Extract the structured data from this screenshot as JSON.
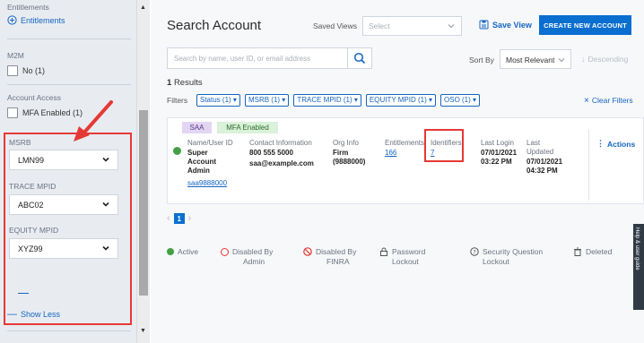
{
  "sidebar": {
    "top_cutoff_label": "Entitlements",
    "entitlements_label": "Entitlements",
    "m2m": {
      "label": "M2M",
      "option": "No (1)"
    },
    "account_access": {
      "label": "Account Access",
      "option": "MFA Enabled (1)"
    },
    "msrb": {
      "label": "MSRB",
      "value": "LMN99"
    },
    "trace_mpid": {
      "label": "TRACE MPID",
      "value": "ABC02"
    },
    "equity_mpid": {
      "label": "EQUITY MPID",
      "value": "XYZ99"
    },
    "show_less": "Show Less"
  },
  "header": {
    "title": "Search Account",
    "saved_views_label": "Saved Views",
    "saved_views_placeholder": "Select",
    "save_view": "Save View",
    "create_account": "CREATE NEW ACCOUNT"
  },
  "search": {
    "placeholder": "Search by name, user ID, or email address",
    "sort_by_label": "Sort By",
    "sort_value": "Most Relevant",
    "descending": "Descending"
  },
  "results": {
    "count": "1",
    "label": "Results"
  },
  "filters": {
    "label": "Filters",
    "chips": [
      "Status (1)",
      "MSRB (1)",
      "TRACE MPID (1)",
      "EQUITY MPID (1)",
      "OSO (1)"
    ],
    "clear": "Clear Filters"
  },
  "result_card": {
    "tags": [
      "SAA",
      "MFA Enabled"
    ],
    "name_header": "Name/User ID",
    "name_lines": [
      "Super",
      "Account",
      "Admin"
    ],
    "user_id": "saa9888000",
    "contact_header": "Contact Information",
    "phone": "800 555 5000",
    "email": "saa@example.com",
    "org_header": "Org Info",
    "org_lines": [
      "Firm",
      "(9888000)"
    ],
    "entitlements_header": "Entitlements",
    "entitlements_value": "166",
    "identifiers_header": "Identifiers",
    "identifiers_value": "7",
    "last_login_header": "Last Login",
    "last_login_lines": [
      "07/01/2021",
      "03:22 PM"
    ],
    "last_updated_header_lines": [
      "Last",
      "Updated"
    ],
    "last_updated_lines": [
      "07/01/2021",
      "04:32 PM"
    ],
    "actions": "Actions"
  },
  "pagination": {
    "prev": "‹",
    "current": "1",
    "next": "›"
  },
  "legend": {
    "active": "Active",
    "disabled_admin": [
      "Disabled By",
      "Admin"
    ],
    "disabled_finra": [
      "Disabled By",
      "FINRA"
    ],
    "password_lockout": [
      "Password",
      "Lockout"
    ],
    "security_lockout": [
      "Security Question",
      "Lockout"
    ],
    "deleted": "Deleted"
  },
  "side_tab": "Help & user guide",
  "colors": {
    "brand_blue": "#0b6fd0",
    "annotation_red": "#e53935",
    "active_green": "#43a047",
    "saa_tag_bg": "#e3d6f3",
    "mfa_tag_bg": "#d9f2d9"
  }
}
